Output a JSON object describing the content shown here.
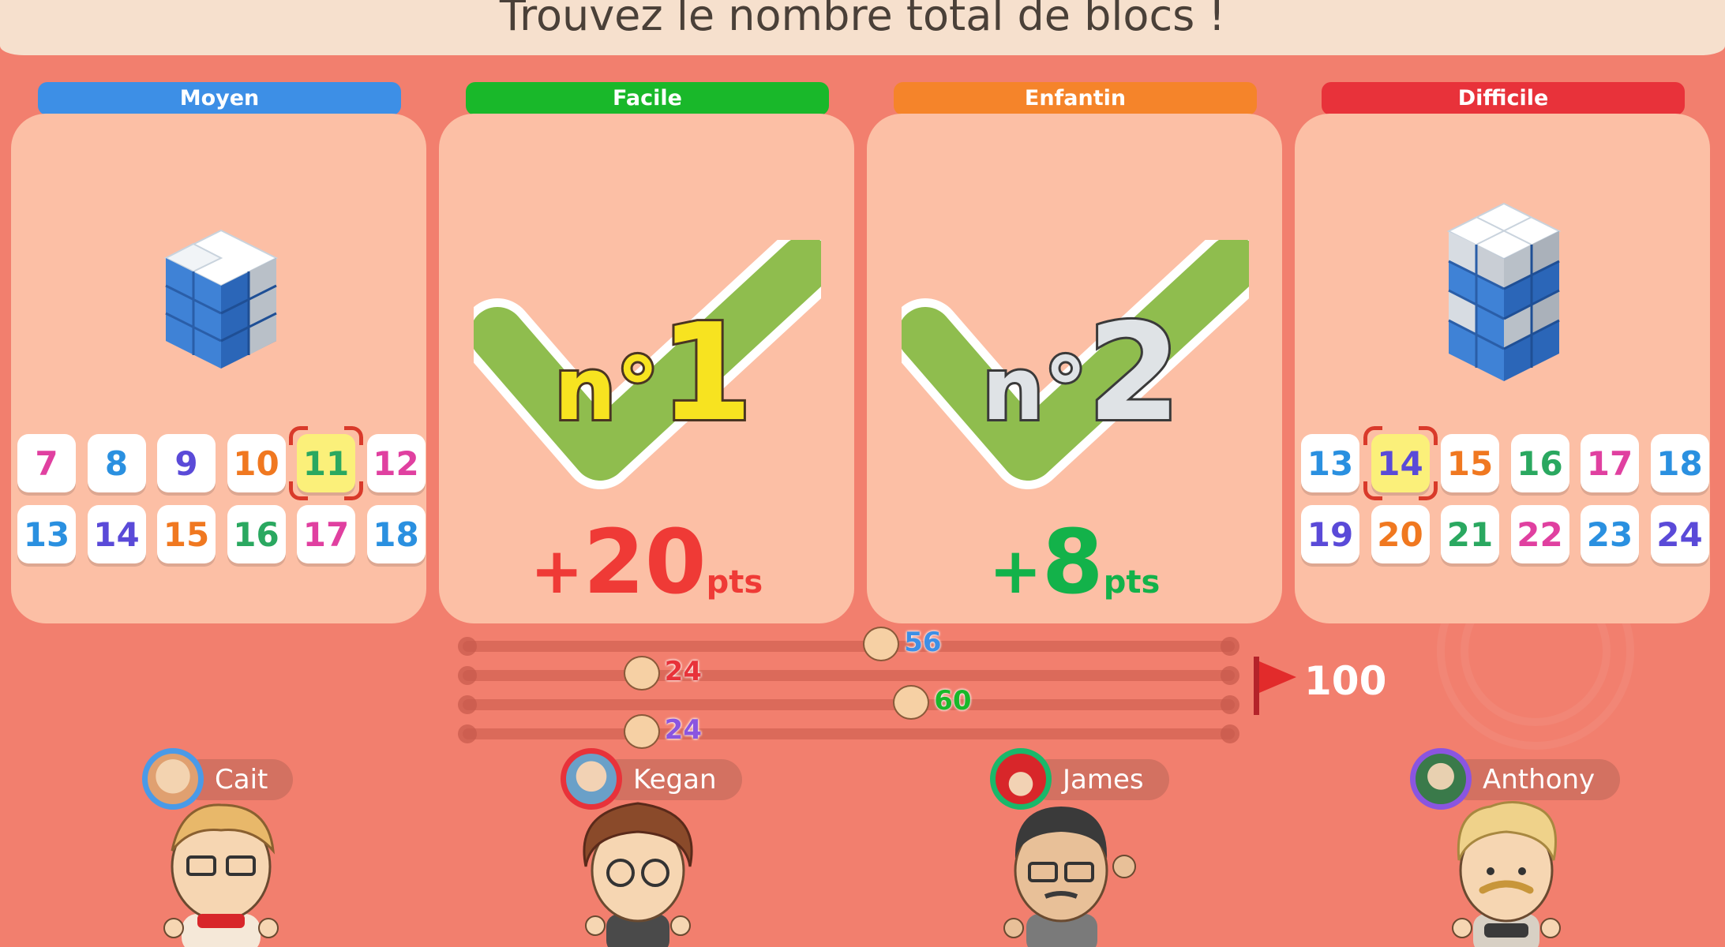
{
  "title": "Trouvez le nombre total de blocs !",
  "panels": [
    {
      "difficulty": "Moyen",
      "color": "#3d8fe6",
      "tiles": [
        "7",
        "8",
        "9",
        "10",
        "11",
        "12",
        "13",
        "14",
        "15",
        "16",
        "17",
        "18"
      ],
      "selected": "11"
    },
    {
      "difficulty": "Facile",
      "color": "#19b82a",
      "rank_prefix": "n°",
      "rank": "1",
      "points_sign": "+",
      "points_value": "20",
      "points_unit": "pts"
    },
    {
      "difficulty": "Enfantin",
      "color": "#f5842a",
      "rank_prefix": "n°",
      "rank": "2",
      "points_sign": "+",
      "points_value": "8",
      "points_unit": "pts"
    },
    {
      "difficulty": "Difficile",
      "color": "#e8323a",
      "tiles": [
        "13",
        "14",
        "15",
        "16",
        "17",
        "18",
        "19",
        "20",
        "21",
        "22",
        "23",
        "24"
      ],
      "selected": "14"
    }
  ],
  "progress": {
    "goal": "100",
    "markers": [
      {
        "score": "56",
        "value": 56,
        "color": "#3d8fe6"
      },
      {
        "score": "24",
        "value": 24,
        "color": "#e8323a"
      },
      {
        "score": "60",
        "value": 60,
        "color": "#19b82a"
      },
      {
        "score": "24",
        "value": 24,
        "color": "#8a55e0"
      }
    ]
  },
  "players": [
    {
      "name": "Cait",
      "ring": "#4a9ae8"
    },
    {
      "name": "Kegan",
      "ring": "#e8323a"
    },
    {
      "name": "James",
      "ring": "#19b86a"
    },
    {
      "name": "Anthony",
      "ring": "#8a55e0"
    }
  ]
}
